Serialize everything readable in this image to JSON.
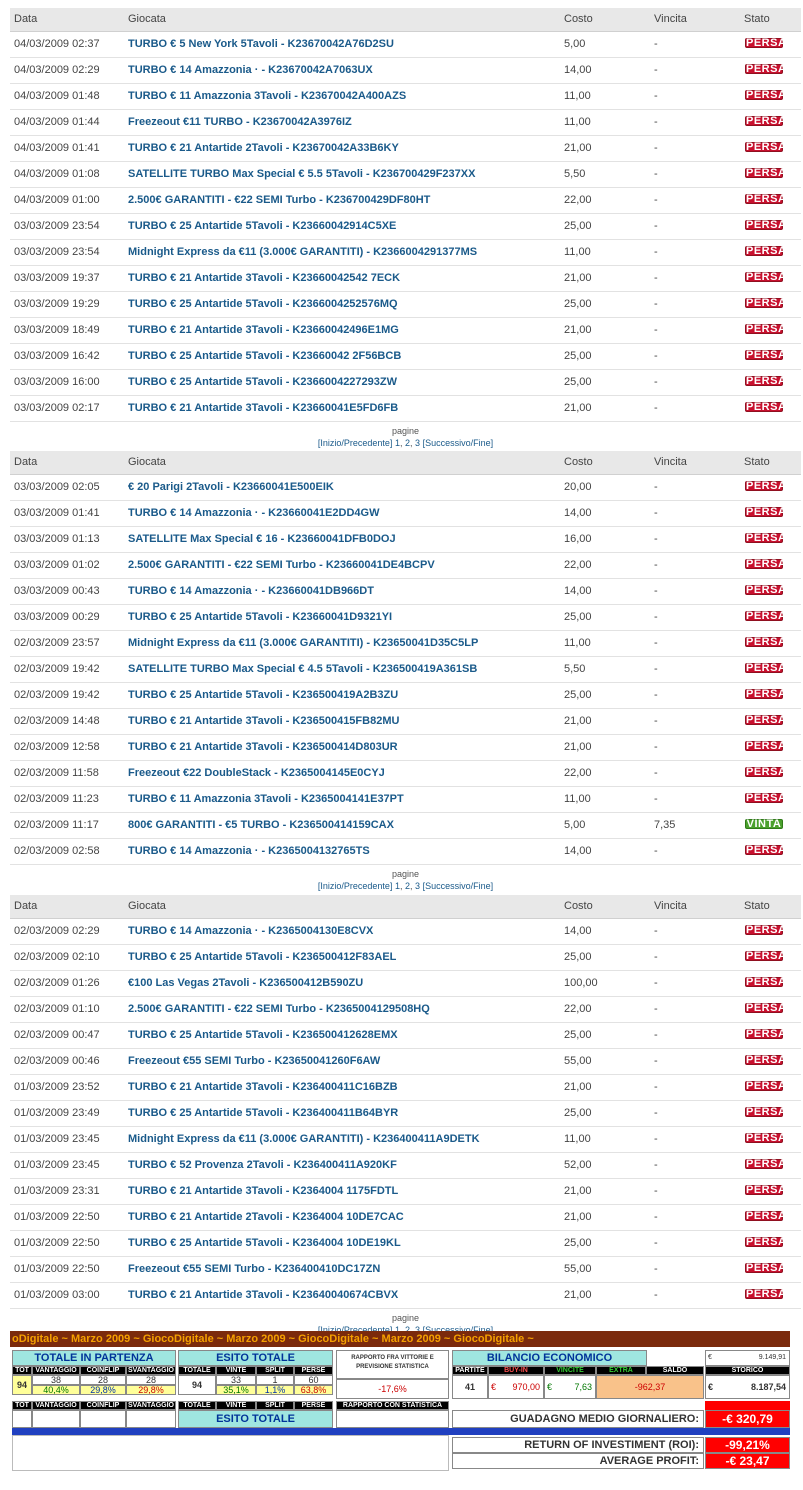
{
  "columns": {
    "data": "Data",
    "giocata": "Giocata",
    "costo": "Costo",
    "vincita": "Vincita",
    "stato": "Stato"
  },
  "badges": {
    "persa": "PERSA",
    "vinta": "VINTA"
  },
  "pager": {
    "label": "pagine",
    "prev": "[Inizio/Precedente]",
    "p1": "1",
    "p2": "2",
    "p3": "3",
    "next": "[Successivo/Fine]",
    "sep": ","
  },
  "tables": [
    {
      "rows": [
        {
          "date": "04/03/2009 02:37",
          "game": "TURBO € 5 New York 5Tavoli - K23670042A76D2SU",
          "cost": "5,00",
          "win": "-",
          "status": "persa"
        },
        {
          "date": "04/03/2009 02:29",
          "game": "TURBO € 14 Amazzonia · - K23670042A7063UX",
          "cost": "14,00",
          "win": "-",
          "status": "persa"
        },
        {
          "date": "04/03/2009 01:48",
          "game": "TURBO € 11 Amazzonia 3Tavoli - K23670042A400AZS",
          "cost": "11,00",
          "win": "-",
          "status": "persa"
        },
        {
          "date": "04/03/2009 01:44",
          "game": "Freezeout €11 TURBO - K23670042A3976IZ",
          "cost": "11,00",
          "win": "-",
          "status": "persa"
        },
        {
          "date": "04/03/2009 01:41",
          "game": "TURBO € 21 Antartide 2Tavoli - K23670042A33B6KY",
          "cost": "21,00",
          "win": "-",
          "status": "persa"
        },
        {
          "date": "04/03/2009 01:08",
          "game": "SATELLITE TURBO Max Special € 5.5 5Tavoli - K236700429F237XX",
          "cost": "5,50",
          "win": "-",
          "status": "persa"
        },
        {
          "date": "04/03/2009 01:00",
          "game": "2.500€ GARANTITI - €22 SEMI Turbo - K236700429DF80HT",
          "cost": "22,00",
          "win": "-",
          "status": "persa"
        },
        {
          "date": "03/03/2009 23:54",
          "game": "TURBO € 25 Antartide 5Tavoli - K23660042914C5XE",
          "cost": "25,00",
          "win": "-",
          "status": "persa"
        },
        {
          "date": "03/03/2009 23:54",
          "game": "Midnight Express da €11 (3.000€ GARANTITI) - K2366004291377MS",
          "cost": "11,00",
          "win": "-",
          "status": "persa"
        },
        {
          "date": "03/03/2009 19:37",
          "game": "TURBO € 21 Antartide 3Tavoli - K23660042542 7ECK",
          "cost": "21,00",
          "win": "-",
          "status": "persa"
        },
        {
          "date": "03/03/2009 19:29",
          "game": "TURBO € 25 Antartide 5Tavoli - K2366004252576MQ",
          "cost": "25,00",
          "win": "-",
          "status": "persa"
        },
        {
          "date": "03/03/2009 18:49",
          "game": "TURBO € 21 Antartide 3Tavoli - K23660042496E1MG",
          "cost": "21,00",
          "win": "-",
          "status": "persa"
        },
        {
          "date": "03/03/2009 16:42",
          "game": "TURBO € 25 Antartide 5Tavoli - K23660042 2F56BCB",
          "cost": "25,00",
          "win": "-",
          "status": "persa"
        },
        {
          "date": "03/03/2009 16:00",
          "game": "TURBO € 25 Antartide 5Tavoli - K2366004227293ZW",
          "cost": "25,00",
          "win": "-",
          "status": "persa"
        },
        {
          "date": "03/03/2009 02:17",
          "game": "TURBO € 21 Antartide 3Tavoli - K23660041E5FD6FB",
          "cost": "21,00",
          "win": "-",
          "status": "persa"
        }
      ]
    },
    {
      "rows": [
        {
          "date": "03/03/2009 02:05",
          "game": "€ 20 Parigi 2Tavoli - K23660041E500EIK",
          "cost": "20,00",
          "win": "-",
          "status": "persa"
        },
        {
          "date": "03/03/2009 01:41",
          "game": "TURBO € 14 Amazzonia · - K23660041E2DD4GW",
          "cost": "14,00",
          "win": "-",
          "status": "persa"
        },
        {
          "date": "03/03/2009 01:13",
          "game": "SATELLITE Max Special € 16 - K23660041DFB0DOJ",
          "cost": "16,00",
          "win": "-",
          "status": "persa"
        },
        {
          "date": "03/03/2009 01:02",
          "game": "2.500€ GARANTITI - €22 SEMI Turbo - K23660041DE4BCPV",
          "cost": "22,00",
          "win": "-",
          "status": "persa"
        },
        {
          "date": "03/03/2009 00:43",
          "game": "TURBO € 14 Amazzonia · - K23660041DB966DT",
          "cost": "14,00",
          "win": "-",
          "status": "persa"
        },
        {
          "date": "03/03/2009 00:29",
          "game": "TURBO € 25 Antartide 5Tavoli - K23660041D9321YI",
          "cost": "25,00",
          "win": "-",
          "status": "persa"
        },
        {
          "date": "02/03/2009 23:57",
          "game": "Midnight Express da €11 (3.000€ GARANTITI) - K23650041D35C5LP",
          "cost": "11,00",
          "win": "-",
          "status": "persa"
        },
        {
          "date": "02/03/2009 19:42",
          "game": "SATELLITE TURBO Max Special € 4.5 5Tavoli - K236500419A361SB",
          "cost": "5,50",
          "win": "-",
          "status": "persa"
        },
        {
          "date": "02/03/2009 19:42",
          "game": "TURBO € 25 Antartide 5Tavoli - K236500419A2B3ZU",
          "cost": "25,00",
          "win": "-",
          "status": "persa"
        },
        {
          "date": "02/03/2009 14:48",
          "game": "TURBO € 21 Antartide 3Tavoli - K236500415FB82MU",
          "cost": "21,00",
          "win": "-",
          "status": "persa"
        },
        {
          "date": "02/03/2009 12:58",
          "game": "TURBO € 21 Antartide 3Tavoli - K236500414D803UR",
          "cost": "21,00",
          "win": "-",
          "status": "persa"
        },
        {
          "date": "02/03/2009 11:58",
          "game": "Freezeout €22 DoubleStack - K2365004145E0CYJ",
          "cost": "22,00",
          "win": "-",
          "status": "persa"
        },
        {
          "date": "02/03/2009 11:23",
          "game": "TURBO € 11 Amazzonia 3Tavoli - K2365004141E37PT",
          "cost": "11,00",
          "win": "-",
          "status": "persa"
        },
        {
          "date": "02/03/2009 11:17",
          "game": "800€ GARANTITI - €5 TURBO - K236500414159CAX",
          "cost": "5,00",
          "win": "7,35",
          "status": "vinta"
        },
        {
          "date": "02/03/2009 02:58",
          "game": "TURBO € 14 Amazzonia · - K2365004132765TS",
          "cost": "14,00",
          "win": "-",
          "status": "persa"
        }
      ]
    },
    {
      "rows": [
        {
          "date": "02/03/2009 02:29",
          "game": "TURBO € 14 Amazzonia · - K2365004130E8CVX",
          "cost": "14,00",
          "win": "-",
          "status": "persa"
        },
        {
          "date": "02/03/2009 02:10",
          "game": "TURBO € 25 Antartide 5Tavoli - K236500412F83AEL",
          "cost": "25,00",
          "win": "-",
          "status": "persa"
        },
        {
          "date": "02/03/2009 01:26",
          "game": "€100 Las Vegas 2Tavoli - K236500412B590ZU",
          "cost": "100,00",
          "win": "-",
          "status": "persa"
        },
        {
          "date": "02/03/2009 01:10",
          "game": "2.500€ GARANTITI - €22 SEMI Turbo - K2365004129508HQ",
          "cost": "22,00",
          "win": "-",
          "status": "persa"
        },
        {
          "date": "02/03/2009 00:47",
          "game": "TURBO € 25 Antartide 5Tavoli - K236500412628EMX",
          "cost": "25,00",
          "win": "-",
          "status": "persa"
        },
        {
          "date": "02/03/2009 00:46",
          "game": "Freezeout €55 SEMI Turbo - K23650041260F6AW",
          "cost": "55,00",
          "win": "-",
          "status": "persa"
        },
        {
          "date": "01/03/2009 23:52",
          "game": "TURBO € 21 Antartide 3Tavoli - K236400411C16BZB",
          "cost": "21,00",
          "win": "-",
          "status": "persa"
        },
        {
          "date": "01/03/2009 23:49",
          "game": "TURBO € 25 Antartide 5Tavoli - K236400411B64BYR",
          "cost": "25,00",
          "win": "-",
          "status": "persa"
        },
        {
          "date": "01/03/2009 23:45",
          "game": "Midnight Express da €11 (3.000€ GARANTITI) - K236400411A9DETK",
          "cost": "11,00",
          "win": "-",
          "status": "persa"
        },
        {
          "date": "01/03/2009 23:45",
          "game": "TURBO € 52 Provenza 2Tavoli - K236400411A920KF",
          "cost": "52,00",
          "win": "-",
          "status": "persa"
        },
        {
          "date": "01/03/2009 23:31",
          "game": "TURBO € 21 Antartide 3Tavoli - K2364004 1175FDTL",
          "cost": "21,00",
          "win": "-",
          "status": "persa"
        },
        {
          "date": "01/03/2009 22:50",
          "game": "TURBO € 21 Antartide 2Tavoli - K2364004 10DE7CAC",
          "cost": "21,00",
          "win": "-",
          "status": "persa"
        },
        {
          "date": "01/03/2009 22:50",
          "game": "TURBO € 25 Antartide 5Tavoli - K2364004 10DE19KL",
          "cost": "25,00",
          "win": "-",
          "status": "persa"
        },
        {
          "date": "01/03/2009 22:50",
          "game": "Freezeout €55 SEMI Turbo - K236400410DC17ZN",
          "cost": "55,00",
          "win": "-",
          "status": "persa"
        },
        {
          "date": "01/03/2009 03:00",
          "game": "TURBO € 21 Antartide 3Tavoli - K23640040674CBVX",
          "cost": "21,00",
          "win": "-",
          "status": "persa"
        }
      ]
    }
  ],
  "summary": {
    "banner": "oDigitale ~ Marzo 2009 ~ GiocoDigitale ~ Marzo 2009 ~ GiocoDigitale ~ Marzo 2009 ~ GiocoDigitale ~",
    "totale_in_partenza": "TOTALE IN PARTENZA",
    "esito_totale": "ESITO TOTALE",
    "rapporto": "RAPPORTO FRA VITTORIE E PREVISIONE STATISTICA",
    "rapporto2": "RAPPORTO CON STATISTICA",
    "bilancio": "BILANCIO ECONOMICO",
    "h_tot": "TOT",
    "h_vantaggio": "VANTAGGIO",
    "h_coinflip": "COINFLIP",
    "h_svantaggio": "SVANTAGGIO",
    "h_totale": "TOTALE",
    "h_vinte": "VINTE",
    "h_split": "SPLIT",
    "h_perse": "PERSE",
    "h_partite": "PARTITE",
    "h_buyin": "BUY-IN",
    "h_vincite": "VINCITE",
    "h_extra": "EXTRA",
    "h_saldo": "SALDO",
    "h_storico": "STORICO",
    "tot": "94",
    "vantaggio": "38",
    "coinflip": "28",
    "svantaggio": "28",
    "vantaggio_pct": "40,4%",
    "coinflip_pct": "29,8%",
    "svantaggio_pct": "29,8%",
    "totale": "94",
    "vinte": "33",
    "split": "1",
    "perse": "60",
    "vinte_pct": "35,1%",
    "split_pct": "1,1%",
    "perse_pct": "63,8%",
    "rapporto_val": "-17,6%",
    "partite": "41",
    "euro": "€",
    "buyin": "970,00",
    "vincite": "7,63",
    "saldo": "-962,37",
    "storico_top": "9.149,91",
    "storico": "8.187,54",
    "guadagno_label": "GUADAGNO MEDIO GIORNALIERO:",
    "guadagno": "-€ 320,79",
    "roi_label": "RETURN OF INVESTIMENT (ROI):",
    "roi": "-99,21%",
    "avg_label": "AVERAGE PROFIT:",
    "avg": "-€ 23,47"
  }
}
